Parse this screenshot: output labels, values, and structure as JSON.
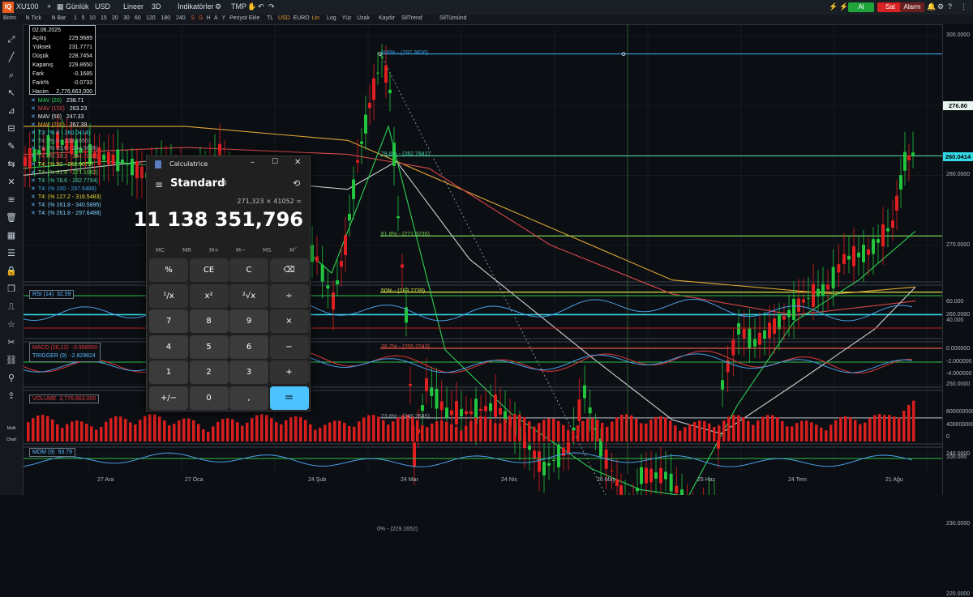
{
  "topbar": {
    "symbol": "XU100",
    "period": "Günlük",
    "currency": "USD",
    "scale": "Lineer",
    "view": "3D",
    "indicators": "İndikatörler",
    "template": "TMP",
    "buy_label": "Al",
    "sell_label": "Sat",
    "alarm_label": "Alarm",
    "buy_color": "#1fa43a",
    "sell_color": "#d62222",
    "alarm_color": "#6a1f1f"
  },
  "toolbar2": {
    "items": [
      "Birim",
      "N Tick",
      "N Bar",
      "1",
      "5",
      "10",
      "15",
      "20",
      "30",
      "60",
      "120",
      "180",
      "240",
      "S",
      "G",
      "H",
      "A",
      "Y",
      "Periyot Ekle",
      "TL",
      "USD",
      "EURO",
      "Lin",
      "Log",
      "Yüz",
      "Uzak",
      "Kaydır",
      "SilTrend",
      "SilTümünd"
    ]
  },
  "infobox": {
    "date": "02.06.2025",
    "rows": [
      {
        "label": "Açılış",
        "value": "229.9689"
      },
      {
        "label": "Yüksek",
        "value": "231.7771"
      },
      {
        "label": "Düşük",
        "value": "228.7454"
      },
      {
        "label": "Kapanış",
        "value": "229.8650"
      },
      {
        "label": "Fark",
        "value": "-0.1685"
      },
      {
        "label": "Fark%",
        "value": "-0.0733"
      },
      {
        "label": "Hacim",
        "value": "2,776,663,000"
      }
    ]
  },
  "legend": [
    {
      "text": "MAV (20)",
      "value": "238.71",
      "color": "#2fd35a"
    },
    {
      "text": "MAV (150)",
      "value": "263.23",
      "color": "#d6484a"
    },
    {
      "text": "MAV (50)",
      "value": "247.33",
      "color": "#e6e6e6"
    },
    {
      "text": "MAV (200)",
      "value": "267.39",
      "color": "#e0a836"
    },
    {
      "text": "T3: (% 0 - 260.0414)",
      "value": "",
      "color": "#34d9e6"
    },
    {
      "text": "T4: (% 0 - 228.1655)",
      "value": "",
      "color": "#9aa3ad"
    },
    {
      "text": "T4: (% 23.6 - 244.5636)",
      "value": "",
      "color": "#9aa3ad"
    },
    {
      "text": "T4: (% 38.2 - 254.7082)",
      "value": "",
      "color": "#e2574b"
    },
    {
      "text": "T4: (% 50 - 262.9072)",
      "value": "",
      "color": "#d8e64a"
    },
    {
      "text": "T4: (% 61.8 - 271.1062)",
      "value": "",
      "color": "#7bd35a"
    },
    {
      "text": "T4: (% 78.6 - 282.7794)",
      "value": "",
      "color": "#4fd0a4"
    },
    {
      "text": "T4: (% 100 - 297.6488)",
      "value": "",
      "color": "#3aa0e6"
    },
    {
      "text": "T4: (% 127.2 - 316.5483)",
      "value": "",
      "color": "#e6d636"
    },
    {
      "text": "T4: (% 161.8 - 340.5895)",
      "value": "",
      "color": "#7bd3ff"
    },
    {
      "text": "T4: (% 261.8 - 297.6488)",
      "value": "",
      "color": "#7bd3ff"
    }
  ],
  "fib_labels": [
    {
      "text": "100% - (297.3826)",
      "color": "#3aa0e6"
    },
    {
      "text": "78.6% - (282.7841)",
      "color": "#4fd0a4"
    },
    {
      "text": "61.8% - (271.3235)",
      "color": "#7bd35a"
    },
    {
      "text": "50% - (263.2739)",
      "color": "#d8e64a"
    },
    {
      "text": "38.2% - (255.2243)",
      "color": "#e2574b"
    },
    {
      "text": "23.6% - (245.2645)",
      "color": "#9aa3ad"
    },
    {
      "text": "0% - (229.1652)",
      "color": "#9aa3ad"
    }
  ],
  "price_axis": {
    "ticks": [
      "300.0000",
      "290.0000",
      "280.0000",
      "270.0000",
      "260.0000",
      "250.0000",
      "240.0000",
      "230.0000",
      "220.0000"
    ],
    "last_price": "276.80",
    "level_badge": "260.0414"
  },
  "panels": {
    "rsi": {
      "name": "RSI (14)",
      "value": "32.59",
      "ticks": [
        "60.000",
        "40.000"
      ]
    },
    "macd": {
      "name": "MACD (26,12)",
      "value": "-3.958550",
      "trigger_name": "TRIGGER (9)",
      "trigger_value": "-2.829824",
      "ticks": [
        "0.000000",
        "-2.000000",
        "-4.000000"
      ]
    },
    "volume": {
      "name": "VOLUME",
      "value": "2,776,663,000",
      "ticks": [
        "8000000000",
        "4000000000",
        "0"
      ]
    },
    "mom": {
      "name": "MOM (9)",
      "value": "93.79",
      "ticks": [
        "100.000"
      ]
    }
  },
  "x_axis": [
    "27 Ara",
    "27 Oca",
    "24 Şub",
    "24 Mar",
    "24 Nis",
    "26 May",
    "25 Haz",
    "24 Tem",
    "21 Ağu"
  ],
  "calculator": {
    "title": "Calculatrice",
    "mode": "Standard",
    "expression": "271,323 × 41052 =",
    "result": "11 138 351,796",
    "memory": [
      "MC",
      "MR",
      "M+",
      "M−",
      "MS",
      "M˅"
    ],
    "keys": [
      "%",
      "CE",
      "C",
      "⌫",
      "¹/x",
      "x²",
      "²√x",
      "÷",
      "7",
      "8",
      "9",
      "×",
      "4",
      "5",
      "6",
      "−",
      "1",
      "2",
      "3",
      "+",
      "+/−",
      "0",
      ",",
      "="
    ]
  }
}
